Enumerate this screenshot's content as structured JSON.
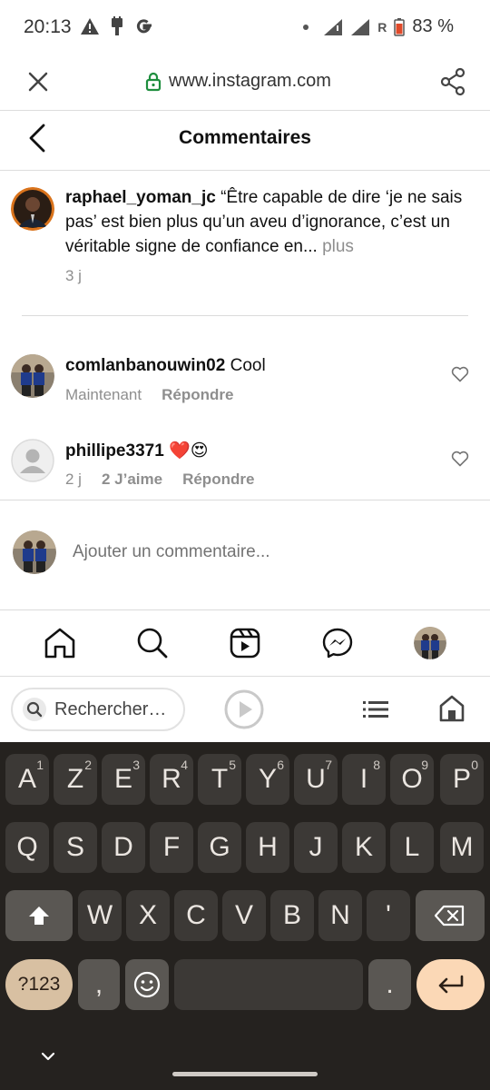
{
  "status_bar": {
    "time": "20:13",
    "battery": "83 %",
    "roaming": "R",
    "left_icons": [
      "warning-icon",
      "usb-icon",
      "google-icon"
    ],
    "right_icons": [
      "signal-icon",
      "signal-icon",
      "battery-icon"
    ]
  },
  "browser": {
    "url": "www.instagram.com",
    "icons": [
      "close-icon",
      "lock-icon",
      "share-icon"
    ]
  },
  "header": {
    "title": "Commentaires"
  },
  "caption": {
    "username": "raphael_yoman_jc",
    "text": " “Être capable de dire ‘je ne sais pas’ est bien plus qu’un aveu d’ignorance, c’est un véritable signe de confiance en...",
    "more": " plus",
    "time": "3 j"
  },
  "comments": [
    {
      "username": "comlanbanouwin02",
      "text": " Cool",
      "time": "Maintenant",
      "likes": "",
      "reply": "Répondre"
    },
    {
      "username": "phillipe3371",
      "text": " ❤️😍",
      "time": "2 j",
      "likes": "2 J’aime",
      "reply": "Répondre"
    }
  ],
  "composer": {
    "placeholder": "Ajouter un commentaire..."
  },
  "bottom_nav": [
    "home-icon",
    "search-icon",
    "reels-icon",
    "messenger-icon",
    "profile-avatar"
  ],
  "keyboard_toolbar": {
    "search_placeholder": "Rechercher…",
    "icons": [
      "play-icon",
      "list-icon",
      "home-outline-icon"
    ]
  },
  "keyboard": {
    "row1": [
      [
        "A",
        "1"
      ],
      [
        "Z",
        "2"
      ],
      [
        "E",
        "3"
      ],
      [
        "R",
        "4"
      ],
      [
        "T",
        "5"
      ],
      [
        "Y",
        "6"
      ],
      [
        "U",
        "7"
      ],
      [
        "I",
        "8"
      ],
      [
        "O",
        "9"
      ],
      [
        "P",
        "0"
      ]
    ],
    "row2": [
      "Q",
      "S",
      "D",
      "F",
      "G",
      "H",
      "J",
      "K",
      "L",
      "M"
    ],
    "row3": [
      "W",
      "X",
      "C",
      "V",
      "B",
      "N",
      "'"
    ],
    "row4": {
      "symbols": "?123",
      "comma": ",",
      "period": "."
    }
  },
  "colors": {
    "keyboard_bg": "#25221f",
    "key_bg": "#3c3936",
    "accent_enter": "#fbd8b6",
    "lock_green": "#1e8e3e"
  }
}
